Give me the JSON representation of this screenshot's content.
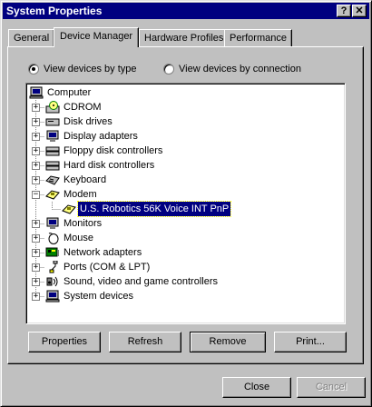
{
  "window": {
    "title": "System Properties",
    "help_label": "?",
    "close_label": "✕"
  },
  "tabs": [
    {
      "label": "General"
    },
    {
      "label": "Device Manager"
    },
    {
      "label": "Hardware Profiles"
    },
    {
      "label": "Performance"
    }
  ],
  "view_options": {
    "by_type": {
      "label": "View devices by type",
      "checked": true
    },
    "by_connection": {
      "label": "View devices by connection",
      "checked": false
    }
  },
  "tree": {
    "root": "Computer",
    "items": [
      {
        "label": "CDROM",
        "icon": "cdrom-icon",
        "expanded": false
      },
      {
        "label": "Disk drives",
        "icon": "disk-drive-icon",
        "expanded": false
      },
      {
        "label": "Display adapters",
        "icon": "monitor-icon",
        "expanded": false
      },
      {
        "label": "Floppy disk controllers",
        "icon": "controller-icon",
        "expanded": false
      },
      {
        "label": "Hard disk controllers",
        "icon": "controller-icon",
        "expanded": false
      },
      {
        "label": "Keyboard",
        "icon": "keyboard-icon",
        "expanded": false
      },
      {
        "label": "Modem",
        "icon": "modem-icon",
        "expanded": true,
        "children": [
          {
            "label": "U.S. Robotics 56K Voice INT PnP",
            "icon": "modem-icon",
            "selected": true
          }
        ]
      },
      {
        "label": "Monitors",
        "icon": "monitor-icon",
        "expanded": false
      },
      {
        "label": "Mouse",
        "icon": "mouse-icon",
        "expanded": false
      },
      {
        "label": "Network adapters",
        "icon": "network-card-icon",
        "expanded": false
      },
      {
        "label": "Ports (COM & LPT)",
        "icon": "port-icon",
        "expanded": false
      },
      {
        "label": "Sound, video and game controllers",
        "icon": "sound-icon",
        "expanded": false
      },
      {
        "label": "System devices",
        "icon": "system-icon",
        "expanded": false
      }
    ]
  },
  "buttons": {
    "properties": "Properties",
    "refresh": "Refresh",
    "remove": "Remove",
    "print": "Print...",
    "close": "Close",
    "cancel": "Cancel"
  }
}
